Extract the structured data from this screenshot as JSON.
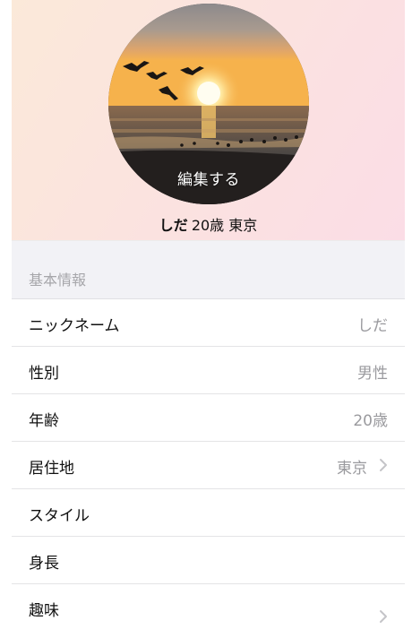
{
  "profile": {
    "edit_label": "編集する",
    "nickname": "しだ",
    "age": "20歳",
    "location": "東京"
  },
  "basic_info": {
    "section_title": "基本情報",
    "rows": [
      {
        "label": "ニックネーム",
        "value": "しだ"
      },
      {
        "label": "性別",
        "value": "男性"
      },
      {
        "label": "年齢",
        "value": "20歳"
      },
      {
        "label": "居住地",
        "value": "東京"
      },
      {
        "label": "スタイル",
        "value": ""
      },
      {
        "label": "身長",
        "value": ""
      },
      {
        "label": "趣味",
        "value": ""
      }
    ]
  },
  "colors": {
    "header_gradient_start": "#fbe9d9",
    "header_gradient_end": "#fbdde6",
    "section_band": "#f2f2f6",
    "value_text": "#9a9a9e",
    "chevron": "#c4c4c8"
  }
}
